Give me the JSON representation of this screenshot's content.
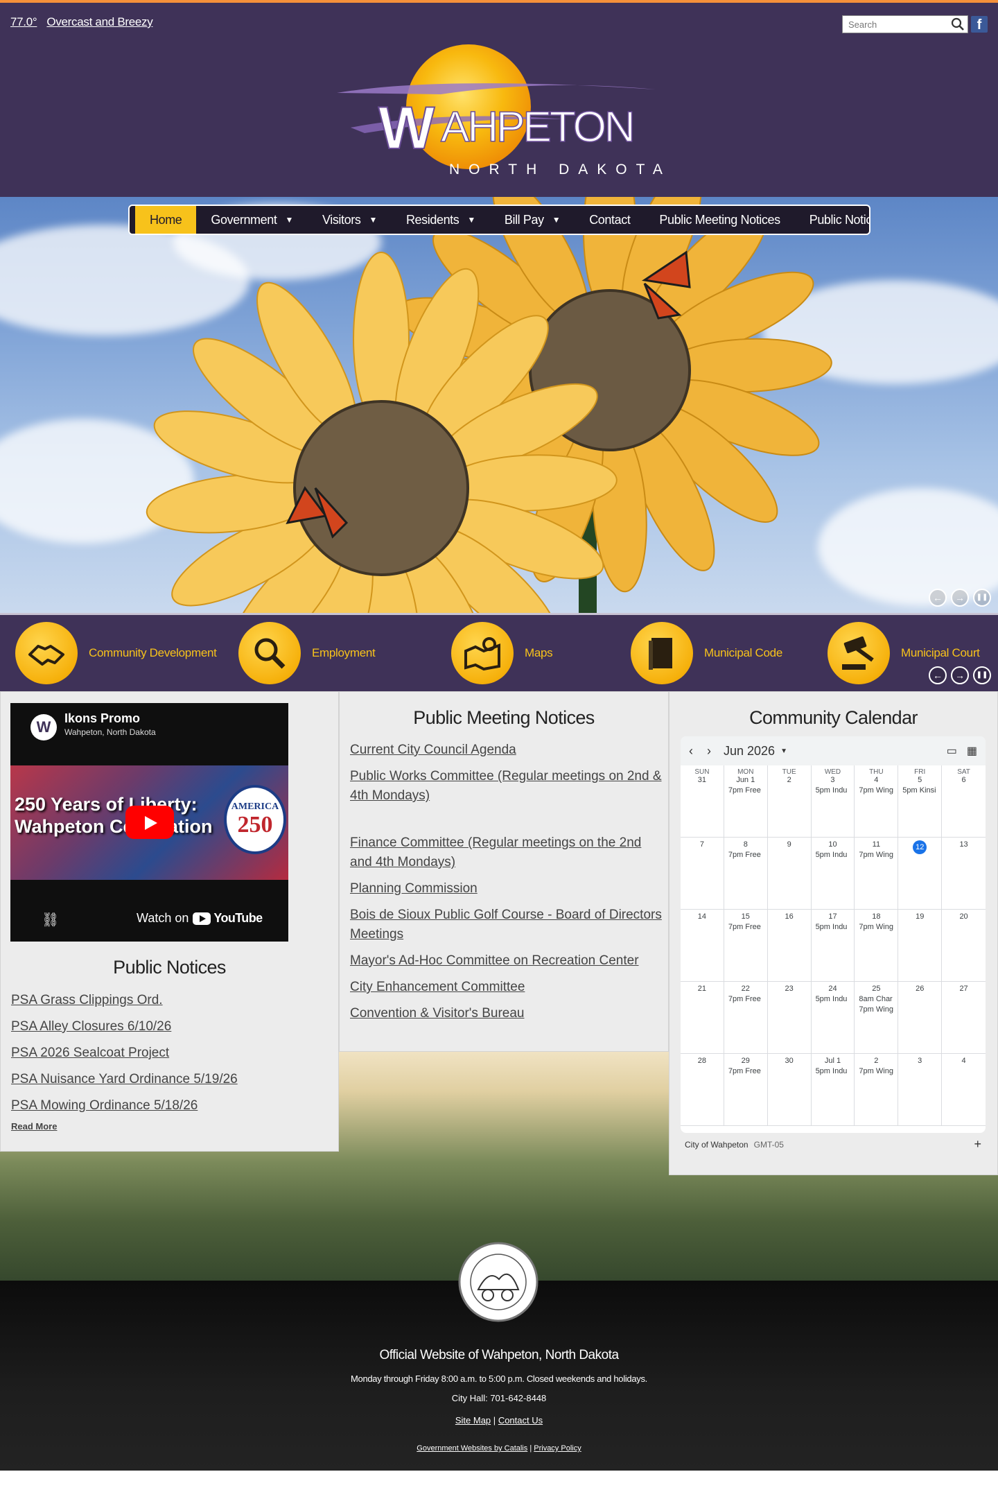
{
  "weather": {
    "temp": "77.0°",
    "condition": "Overcast and Breezy"
  },
  "search": {
    "placeholder": "Search"
  },
  "social": {
    "facebook": "f"
  },
  "logo": {
    "name": "WAHPETON",
    "subtitle": "NORTH DAKOTA"
  },
  "nav": {
    "items": [
      {
        "label": "Home",
        "caret": ""
      },
      {
        "label": "Government",
        "caret": "▼"
      },
      {
        "label": "Visitors",
        "caret": "▼"
      },
      {
        "label": "Residents",
        "caret": "▼"
      },
      {
        "label": "Bill Pay",
        "caret": "▼"
      },
      {
        "label": "Contact",
        "caret": ""
      },
      {
        "label": "Public Meeting Notices",
        "caret": ""
      },
      {
        "label": "Public Notices",
        "caret": "▼"
      }
    ]
  },
  "slider": {
    "prev": "←",
    "next": "→",
    "pause": "❚❚"
  },
  "quicklinks": [
    {
      "label": "Community Development",
      "icon": "handshake-icon"
    },
    {
      "label": "Employment",
      "icon": "magnifier-icon"
    },
    {
      "label": "Maps",
      "icon": "map-icon"
    },
    {
      "label": "Municipal Code",
      "icon": "book-icon"
    },
    {
      "label": "Municipal Court",
      "icon": "gavel-icon"
    }
  ],
  "video": {
    "channel": "Ikons Promo",
    "location": "Wahpeton, North Dakota",
    "title_line1": "250 Years of Liberty:",
    "title_line2": "Wahpeton Celebration",
    "badge_top": "AMERICA",
    "badge_num": "250",
    "watch_on": "Watch on",
    "youtube": "YouTube"
  },
  "public_notices": {
    "title": "Public Notices",
    "items": [
      "PSA Grass Clippings Ord.",
      "PSA Alley Closures 6/10/26",
      "PSA 2026 Sealcoat Project",
      "PSA Nuisance Yard Ordinance 5/19/26",
      "PSA Mowing Ordinance 5/18/26"
    ],
    "read_more": "Read More"
  },
  "meeting_notices": {
    "title": "Public Meeting Notices",
    "items": [
      "Current City Council Agenda",
      "Public Works Committee (Regular meetings on 2nd & 4th Mondays)",
      "Finance Committee (Regular meetings on the 2nd and 4th Mondays)",
      "Planning Commission",
      "Bois de Sioux Public Golf Course - Board of Directors Meetings",
      "Mayor's Ad-Hoc Committee on Recreation Center",
      "City Enhancement Committee",
      "Convention & Visitor's Bureau"
    ]
  },
  "calendar": {
    "title": "Community Calendar",
    "month": "Jun 2026",
    "calendar_name": "City of Wahpeton",
    "timezone": "GMT-05",
    "add": "+",
    "dows": [
      "SUN",
      "MON",
      "TUE",
      "WED",
      "THU",
      "FRI",
      "SAT"
    ],
    "weeks": [
      [
        {
          "d": "31",
          "ev": []
        },
        {
          "d": "Jun 1",
          "ev": [
            "7pm Free"
          ]
        },
        {
          "d": "2",
          "ev": []
        },
        {
          "d": "3",
          "ev": [
            "5pm Indu"
          ]
        },
        {
          "d": "4",
          "ev": [
            "7pm Wing"
          ]
        },
        {
          "d": "5",
          "ev": [
            "5pm Kinsi"
          ]
        },
        {
          "d": "6",
          "ev": []
        }
      ],
      [
        {
          "d": "7",
          "ev": []
        },
        {
          "d": "8",
          "ev": [
            "7pm Free"
          ]
        },
        {
          "d": "9",
          "ev": []
        },
        {
          "d": "10",
          "ev": [
            "5pm Indu"
          ]
        },
        {
          "d": "11",
          "ev": [
            "7pm Wing"
          ]
        },
        {
          "d": "12",
          "ev": [],
          "today": true
        },
        {
          "d": "13",
          "ev": []
        }
      ],
      [
        {
          "d": "14",
          "ev": []
        },
        {
          "d": "15",
          "ev": [
            "7pm Free"
          ]
        },
        {
          "d": "16",
          "ev": []
        },
        {
          "d": "17",
          "ev": [
            "5pm Indu"
          ]
        },
        {
          "d": "18",
          "ev": [
            "7pm Wing"
          ]
        },
        {
          "d": "19",
          "ev": []
        },
        {
          "d": "20",
          "ev": []
        }
      ],
      [
        {
          "d": "21",
          "ev": []
        },
        {
          "d": "22",
          "ev": [
            "7pm Free"
          ]
        },
        {
          "d": "23",
          "ev": []
        },
        {
          "d": "24",
          "ev": [
            "5pm Indu"
          ]
        },
        {
          "d": "25",
          "ev": [
            "8am Char",
            "7pm Wing"
          ]
        },
        {
          "d": "26",
          "ev": []
        },
        {
          "d": "27",
          "ev": []
        }
      ],
      [
        {
          "d": "28",
          "ev": []
        },
        {
          "d": "29",
          "ev": [
            "7pm Free"
          ]
        },
        {
          "d": "30",
          "ev": []
        },
        {
          "d": "Jul 1",
          "ev": [
            "5pm Indu"
          ]
        },
        {
          "d": "2",
          "ev": [
            "7pm Wing"
          ]
        },
        {
          "d": "3",
          "ev": []
        },
        {
          "d": "4",
          "ev": []
        }
      ]
    ]
  },
  "footer": {
    "title": "Official Website of Wahpeton, North Dakota",
    "hours": "Monday through Friday 8:00 a.m. to 5:00 p.m. Closed weekends and holidays.",
    "phone": "City Hall: 701-642-8448",
    "site_map": "Site Map",
    "separator": "|",
    "contact_us": "Contact Us",
    "credits": "Government Websites by Catalis",
    "privacy": "Privacy Policy"
  },
  "colors": {
    "accent": "#f7c21b",
    "header": "#3f3258",
    "nav": "#1f1a2b",
    "today": "#1a73e8"
  }
}
